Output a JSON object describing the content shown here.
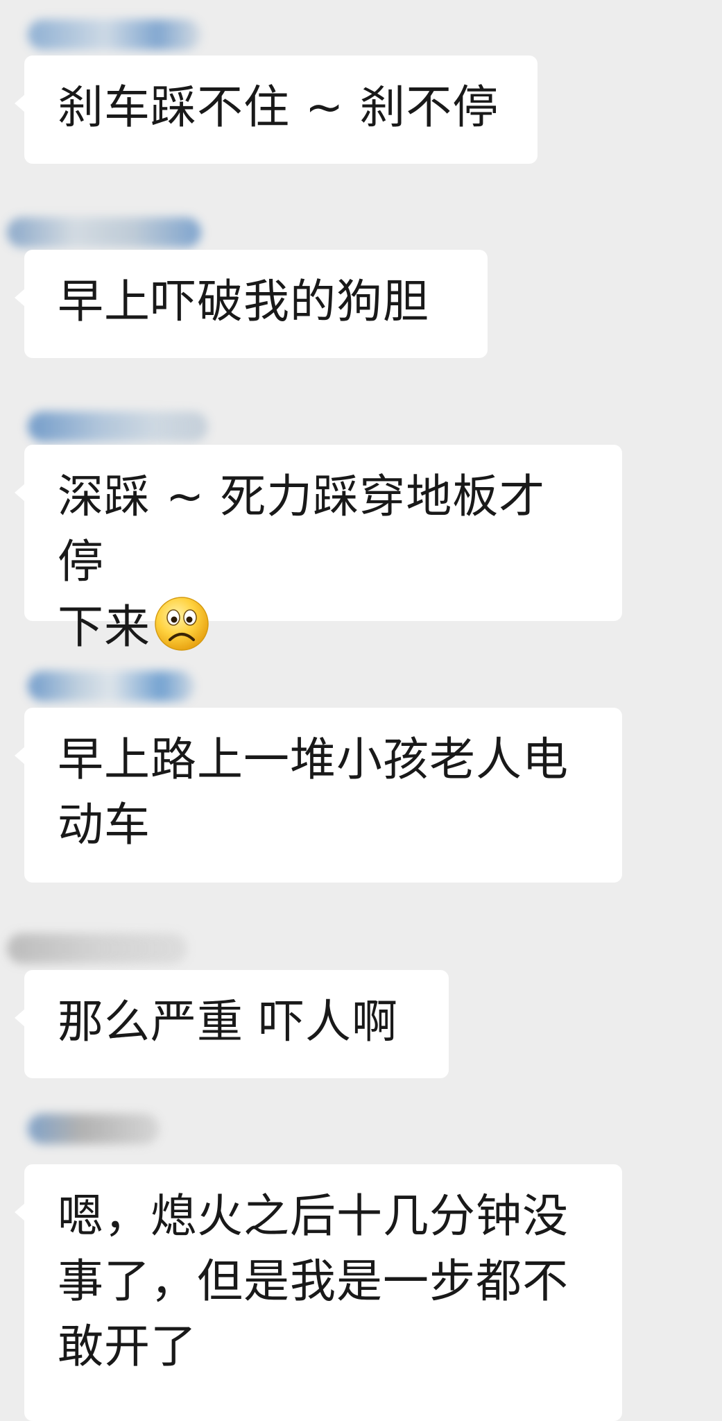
{
  "chat": {
    "messages": [
      {
        "text": "刹车踩不住 ~ 刹不停",
        "emoji": null
      },
      {
        "text": "早上吓破我的狗胆",
        "emoji": null
      },
      {
        "text": "深踩 ~ 死力踩穿地板才停\n下来",
        "emoji": "frowning-face-emoji"
      },
      {
        "text": "早上路上一堆小孩老人电\n动车",
        "emoji": null
      },
      {
        "text": "那么严重 吓人啊",
        "emoji": null
      },
      {
        "text": "嗯，熄火之后十几分钟没\n事了，但是我是一步都不\n敢开了",
        "emoji": null
      }
    ]
  },
  "colors": {
    "background": "#ededed",
    "bubble": "#ffffff",
    "text": "#191919",
    "blurred_name_a": "#5b8fc7",
    "blurred_name_b": "#a9a9a9"
  }
}
